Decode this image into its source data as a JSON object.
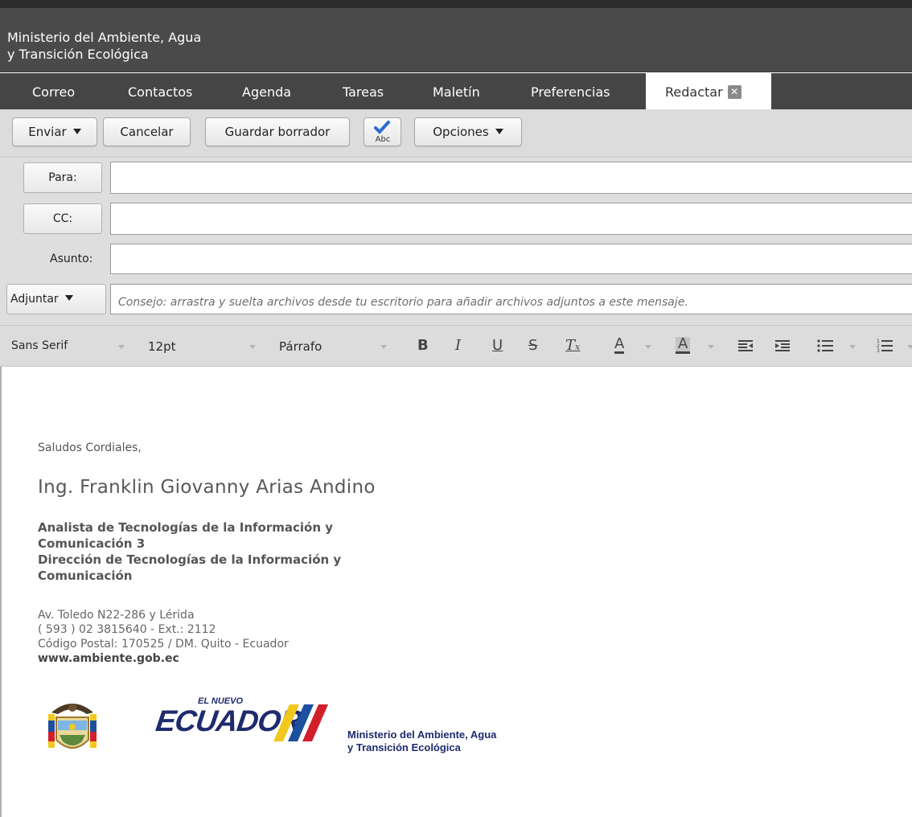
{
  "header": {
    "org_line1": "Ministerio del Ambiente, Agua",
    "org_line2": "y Transición Ecológica"
  },
  "tabs": [
    {
      "label": "Correo"
    },
    {
      "label": "Contactos"
    },
    {
      "label": "Agenda"
    },
    {
      "label": "Tareas"
    },
    {
      "label": "Maletín"
    },
    {
      "label": "Preferencias"
    },
    {
      "label": "Redactar",
      "active": true
    }
  ],
  "toolbar": {
    "send": "Enviar",
    "cancel": "Cancelar",
    "save_draft": "Guardar borrador",
    "spell_icon_text": "Abc",
    "options": "Opciones"
  },
  "fields": {
    "to_button": "Para:",
    "to_value": "",
    "cc_button": "CC:",
    "cc_value": "",
    "subject_label": "Asunto:",
    "subject_value": "",
    "attach_button": "Adjuntar",
    "attach_hint": "Consejo: arrastra y suelta archivos desde tu escritorio para añadir archivos adjuntos a este mensaje."
  },
  "format": {
    "font": "Sans Serif",
    "size": "12pt",
    "block": "Párrafo"
  },
  "body": {
    "greeting": "Saludos Cordiales,",
    "name": "Ing. Franklin Giovanny Arias Andino",
    "role1": "Analista de Tecnologías de la Información y Comunicación 3",
    "role2": "Dirección de Tecnologías de la Información y Comunicación",
    "addr1": "Av. Toledo N22-286 y Lérida",
    "addr2": "( 593 ) 02 3815640 - Ext.: 2112",
    "addr3": "Código Postal: 170525 / DM. Quito - Ecuador",
    "web": "www.ambiente.gob.ec",
    "logo_tag": "EL NUEVO",
    "logo_main": "ECUADOR",
    "logo_ministry1": "Ministerio del Ambiente, Agua",
    "logo_ministry2": "y Transición Ecológica"
  },
  "colors": {
    "header_bg": "#4a4a4a",
    "tabs_bg": "#454545",
    "logo_blue": "#1e2b6e",
    "flag_yellow": "#f2c81c",
    "flag_blue": "#1d4fa0",
    "flag_red": "#d21f2c"
  }
}
